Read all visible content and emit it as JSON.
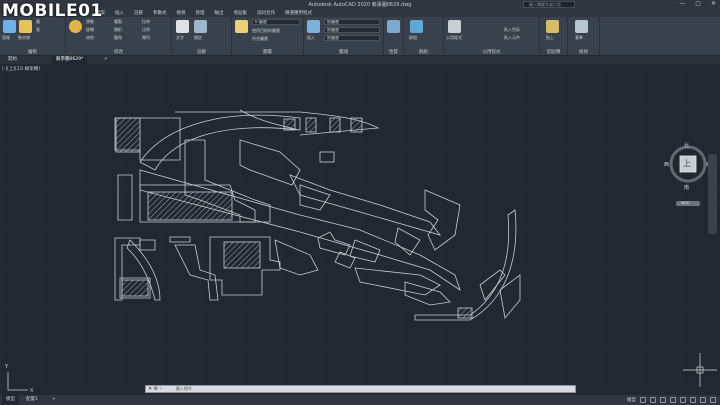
{
  "watermark": "MOBILE01",
  "window": {
    "title": "Autodesk AutoCAD 2020  競爭圖0629.dwg",
    "search_placeholder": "鍵入關鍵字或片語",
    "controls": [
      "—",
      "▢",
      "✕"
    ]
  },
  "menu": [
    "檔案",
    "插入",
    "註解",
    "參數式",
    "檢視",
    "管理",
    "輸出",
    "增益集",
    "協同合作",
    "精選應用程式"
  ],
  "ribbon": {
    "panels": [
      {
        "title": "繪製",
        "buttons": [
          "線",
          "聚合線",
          "圓",
          "弧"
        ]
      },
      {
        "title": "修改",
        "buttons": [
          "移動",
          "旋轉",
          "修剪",
          "複製",
          "鏡射",
          "圓角",
          "拉伸",
          "比例",
          "陣列"
        ]
      },
      {
        "title": "註解",
        "buttons": [
          "文字",
          "標註"
        ]
      },
      {
        "title": "圖層",
        "buttons": [
          "圖層性質"
        ]
      },
      {
        "title": "圖塊",
        "buttons": [
          "插入",
          "建立"
        ]
      },
      {
        "title": "性質",
        "buttons": [
          "符合性質"
        ]
      },
      {
        "title": "群組",
        "buttons": [
          "群組"
        ]
      },
      {
        "title": "公用程式",
        "buttons": [
          "測量"
        ]
      },
      {
        "title": "剪貼簿",
        "buttons": [
          "貼上"
        ]
      },
      {
        "title": "檢視",
        "buttons": [
          "基準"
        ]
      }
    ],
    "labels": {
      "draw_big": [
        "直線",
        "聚合線",
        "圓",
        "弧"
      ],
      "modify_small": [
        "移動",
        "旋轉",
        "修剪",
        "複製",
        "鏡射",
        "圓角",
        "拉伸",
        "比例",
        "陣列"
      ],
      "annotation_big": [
        "文字",
        "標註"
      ],
      "layer_dd1": "0  圖層",
      "layer_dd2": "使用目前的圖層",
      "layer_dd3": "符合圖層",
      "insert_label": "插入",
      "match_label": "符合性質",
      "group_label": "群組",
      "measure_label": "公用程式",
      "paste_label": "貼上",
      "base_label": "基準",
      "properties_dd": [
        "依圖層",
        "依圖層",
        "依圖層"
      ],
      "prop_right": [
        "貼入色彩",
        "貼入元件"
      ]
    }
  },
  "tabs": {
    "start": "開始",
    "file": "競爭圖0629*",
    "add": "+"
  },
  "viewport": {
    "label": "[-][上][2D 線架構]"
  },
  "viewcube": {
    "north": "北",
    "south": "南",
    "east": "東",
    "west": "西",
    "top": "上",
    "wcs": "WCS"
  },
  "ucs": {
    "x": "X",
    "y": "Y"
  },
  "command": {
    "prompt": "鍵入指令"
  },
  "status": {
    "model": "模型",
    "layout": "配置1",
    "add": "+",
    "model_right": "模型"
  },
  "colors": {
    "canvas": "#212830",
    "ribbon": "#38414c",
    "line": "#c9ced4",
    "hatch": "#bfc4ca"
  }
}
